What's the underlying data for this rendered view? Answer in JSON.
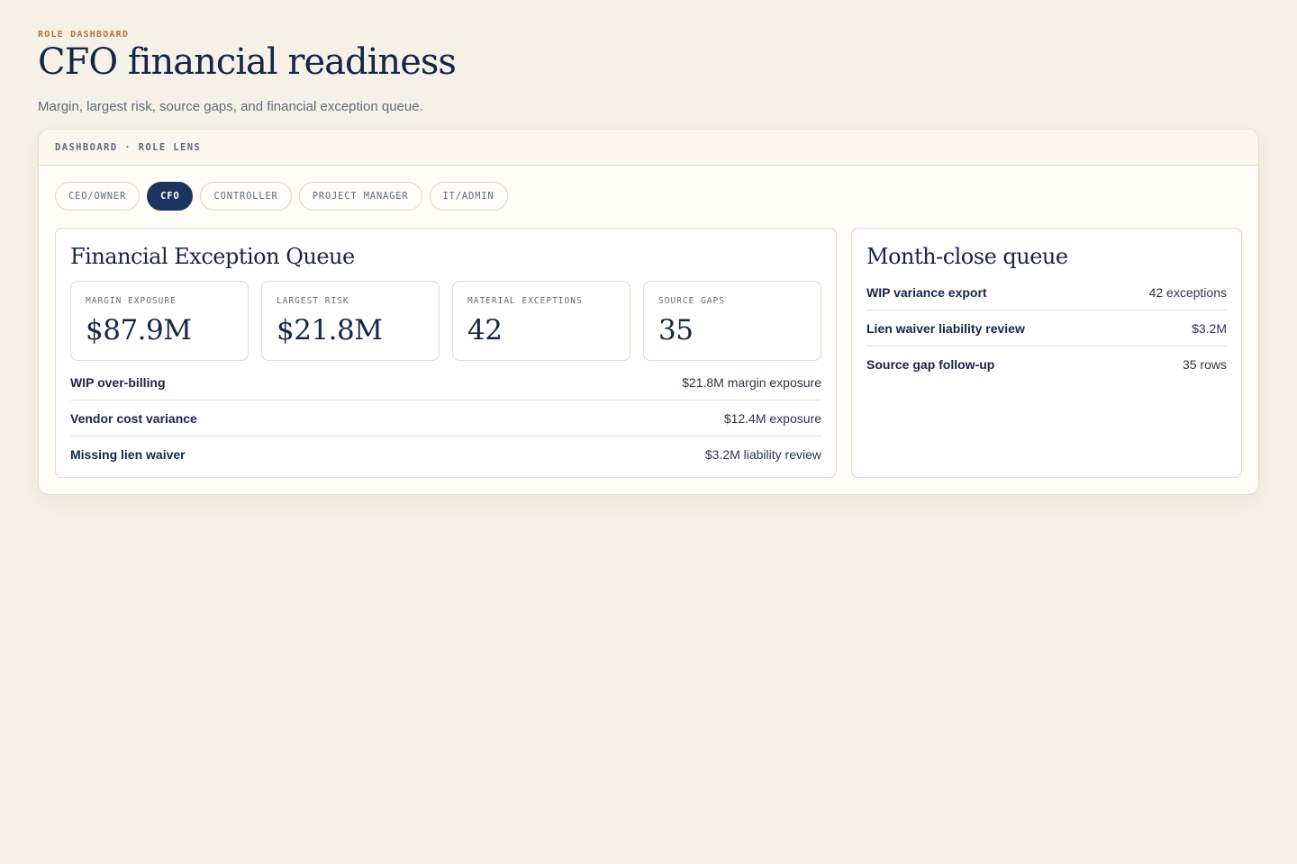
{
  "header": {
    "eyebrow": "ROLE DASHBOARD",
    "title": "CFO financial readiness",
    "subtitle": "Margin, largest risk, source gaps, and financial exception queue."
  },
  "panel": {
    "breadcrumb": "DASHBOARD · ROLE LENS"
  },
  "tabs": [
    {
      "label": "CEO/OWNER",
      "active": false
    },
    {
      "label": "CFO",
      "active": true
    },
    {
      "label": "CONTROLLER",
      "active": false
    },
    {
      "label": "PROJECT MANAGER",
      "active": false
    },
    {
      "label": "IT/ADMIN",
      "active": false
    }
  ],
  "main_card": {
    "title": "Financial Exception Queue",
    "kpis": [
      {
        "label": "MARGIN EXPOSURE",
        "value": "$87.9M"
      },
      {
        "label": "LARGEST RISK",
        "value": "$21.8M"
      },
      {
        "label": "MATERIAL EXCEPTIONS",
        "value": "42"
      },
      {
        "label": "SOURCE GAPS",
        "value": "35"
      }
    ],
    "rows": [
      {
        "label": "WIP over-billing",
        "value": "$21.8M margin exposure"
      },
      {
        "label": "Vendor cost variance",
        "value": "$12.4M exposure"
      },
      {
        "label": "Missing lien waiver",
        "value": "$3.2M liability review"
      }
    ]
  },
  "side_card": {
    "title": "Month-close queue",
    "rows": [
      {
        "label": "WIP variance export",
        "value": "42 exceptions"
      },
      {
        "label": "Lien waiver liability review",
        "value": "$3.2M"
      },
      {
        "label": "Source gap follow-up",
        "value": "35 rows"
      }
    ]
  },
  "colors": {
    "background": "#f5f1e6",
    "accent_navy": "#1b3560",
    "eyebrow_orange": "#b5713a"
  }
}
